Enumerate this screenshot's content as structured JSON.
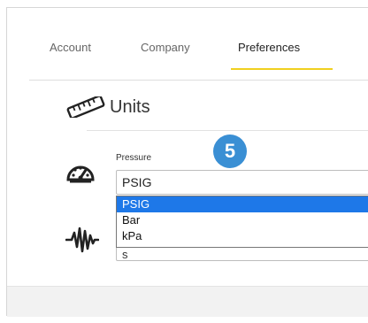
{
  "tabs": [
    {
      "label": "Account",
      "active": false
    },
    {
      "label": "Company",
      "active": false
    },
    {
      "label": "Preferences",
      "active": true
    }
  ],
  "section": {
    "title": "Units",
    "icon": "ruler-icon"
  },
  "pressure": {
    "label": "Pressure",
    "value": "PSIG",
    "icon": "gauge-icon",
    "options": [
      "PSIG",
      "Bar",
      "kPa"
    ],
    "selected_option": "PSIG"
  },
  "second_field": {
    "value_partial": "s",
    "icon": "waveform-icon"
  },
  "step_badge": "5",
  "colors": {
    "active_tab_underline": "#f0d020",
    "badge": "#3a8fd4",
    "selected_option": "#1e78e8"
  }
}
